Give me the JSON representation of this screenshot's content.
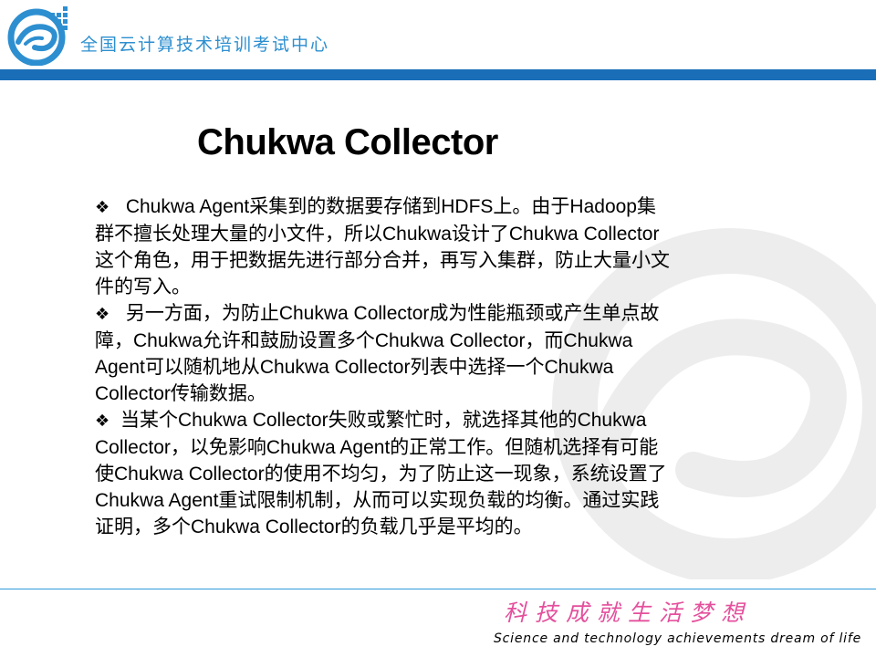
{
  "header": {
    "logo_icon": "cloud-swirl-logo-icon",
    "org_name": "全国云计算技术培训考试中心",
    "bar_color": "#1a6eb8"
  },
  "slide": {
    "title": "Chukwa Collector",
    "bullet_icon": "diamond-bullet-icon",
    "paragraphs": [
      {
        "bullet": "❖",
        "lines": [
          " Chukwa Agent采集到的数据要存储到HDFS上。由于Hadoop集",
          "群不擅长处理大量的小文件，所以Chukwa设计了Chukwa Collector",
          "这个角色，用于把数据先进行部分合并，再写入集群，防止大量小文",
          "件的写入。"
        ]
      },
      {
        "bullet": "❖",
        "lines": [
          " 另一方面，为防止Chukwa Collector成为性能瓶颈或产生单点故",
          "障，Chukwa允许和鼓励设置多个Chukwa Collector，而Chukwa",
          "Agent可以随机地从Chukwa Collector列表中选择一个Chukwa",
          "Collector传输数据。"
        ]
      },
      {
        "bullet": "❖",
        "lines": [
          "当某个Chukwa Collector失败或繁忙时，就选择其他的Chukwa",
          "Collector，以免影响Chukwa Agent的正常工作。但随机选择有可能",
          "使Chukwa Collector的使用不均匀，为了防止这一现象，系统设置了",
          "Chukwa Agent重试限制机制，从而可以实现负载的均衡。通过实践",
          "证明，多个Chukwa Collector的负载几乎是平均的。"
        ]
      }
    ]
  },
  "footer": {
    "slogan_cn": "科技成就生活梦想",
    "slogan_en": "Science and technology achievements dream of life",
    "line_color": "#2d9ad8"
  }
}
